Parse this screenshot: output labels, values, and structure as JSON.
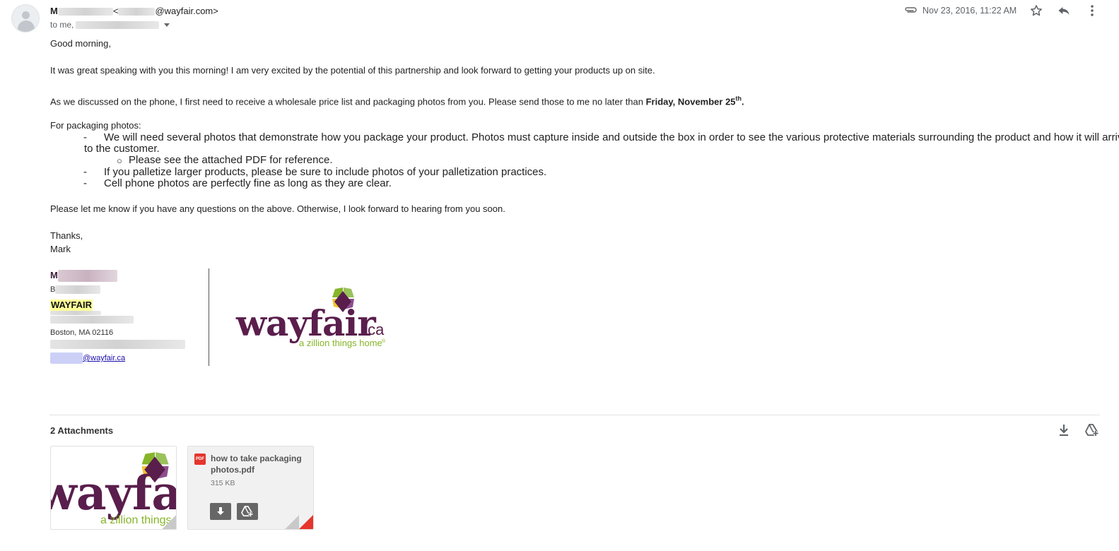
{
  "header": {
    "sender_initial": "M",
    "sender_email_suffix": "@wayfair.com>",
    "to_prefix": "to me,",
    "date": "Nov 23, 2016, 11:22 AM",
    "icons": [
      "attachment-icon",
      "star-icon",
      "reply-icon",
      "more-vert-icon"
    ]
  },
  "body": {
    "greeting": "Good morning,",
    "para1": "It was great speaking with you this morning! I am very excited by the potential of this partnership and look forward to getting your products up on site.",
    "para2_text": "As we discussed on the phone, I first need to receive a wholesale price list and packaging photos from you. Please send those to me no later than ",
    "para2_bold": "Friday, November 25",
    "para2_sup": "th",
    "para2_end": ".",
    "packaging_heading": "For packaging photos:",
    "bullet_dash": "-",
    "bullet1_line1": "We will need several photos that demonstrate how you package your product. Photos must capture inside and outside the box in order to see the various protective materials surrounding the product and how it will arrive",
    "bullet1_line2": "to the customer.",
    "sub_bullet_marker": "○",
    "sub_bullet": "Please see the attached PDF for reference.",
    "bullet2": "If you palletize larger products, please be sure to include photos of your palletization practices.",
    "bullet3": "Cell phone photos are perfectly fine as long as they are clear.",
    "closing": "Please let me know if you have any questions on the above. Otherwise, I look forward to hearing from you soon.",
    "thanks": "Thanks,",
    "name": "Mark"
  },
  "signature": {
    "name_initial": "M",
    "title_initial": "B",
    "brand": "WAYFAIR",
    "address": "Boston, MA 02116",
    "email_domain": "@wayfair.ca",
    "logo_word": "wayfair",
    "logo_suffix": ".ca",
    "logo_tagline": "a zillion things home",
    "logo_mark": "®"
  },
  "attachments": {
    "title": "2 Attachments",
    "items": [
      {
        "type": "image",
        "logo_word": "wayfair",
        "tagline": "a zillion things"
      },
      {
        "type": "pdf",
        "badge": "PDF",
        "name": "how to take packaging photos.pdf",
        "size": "315 KB"
      }
    ]
  },
  "colors": {
    "brand_purple": "#5a1e4c",
    "brand_green": "#86b52a",
    "pdf_red": "#e5352c",
    "link": "#1a0dab"
  }
}
